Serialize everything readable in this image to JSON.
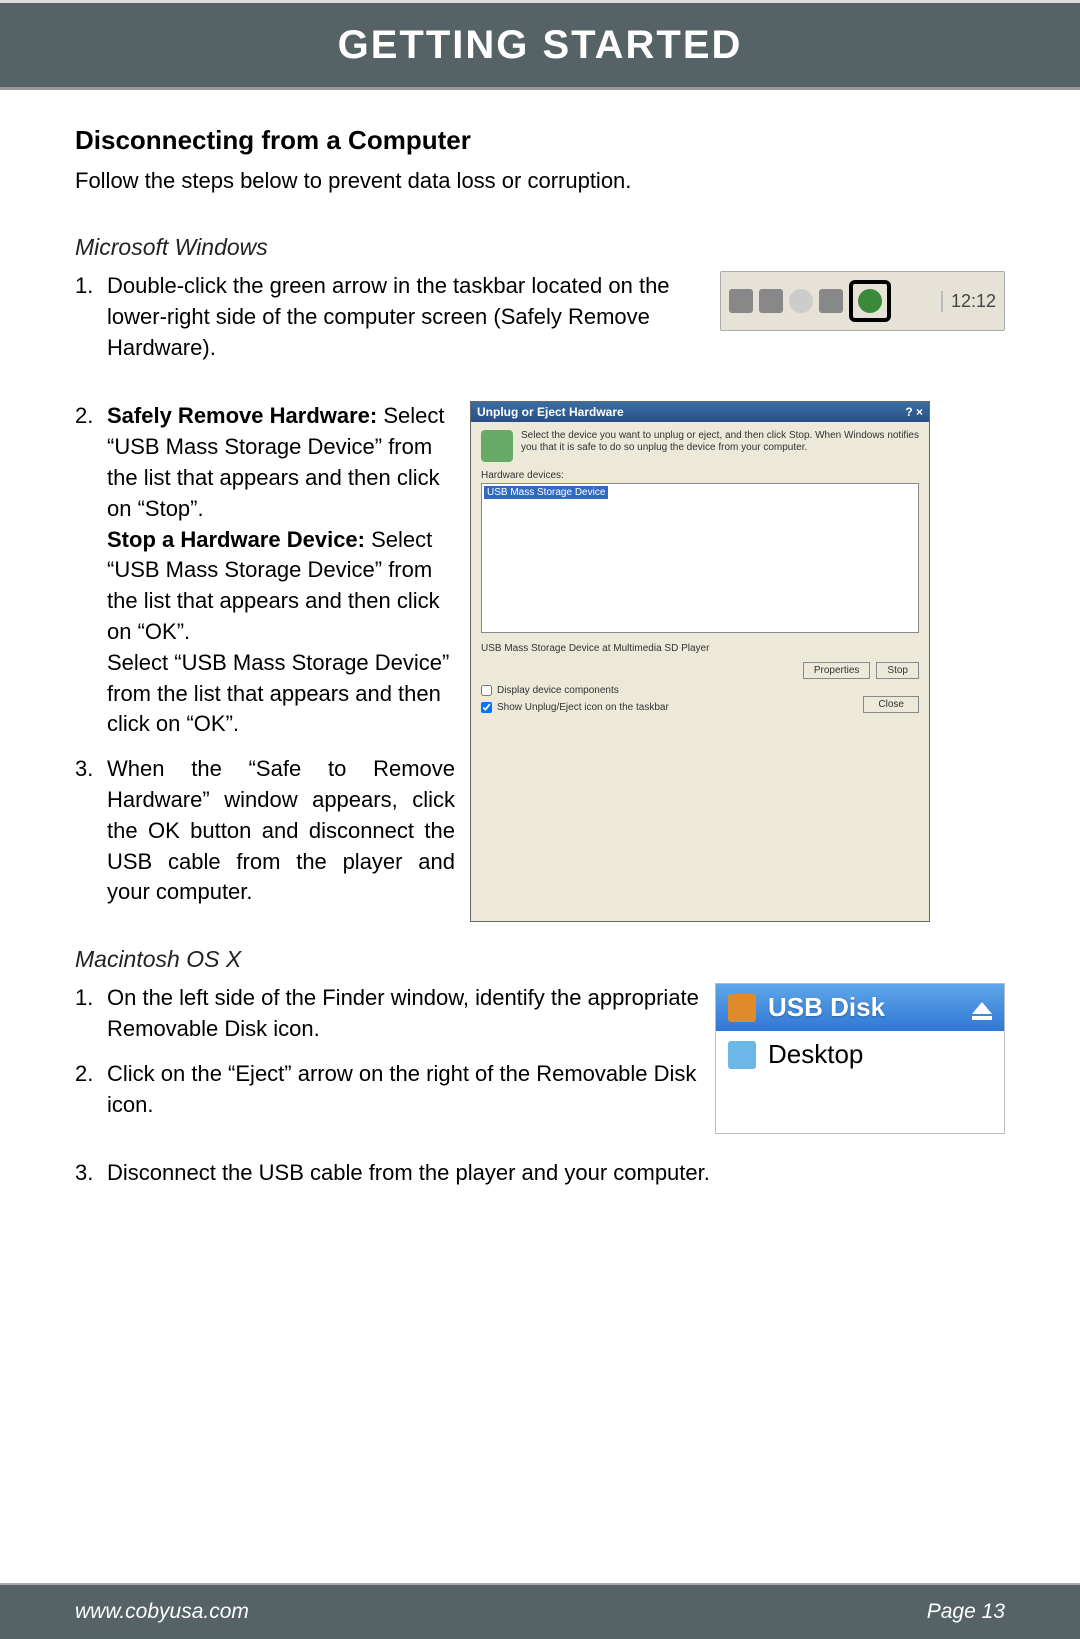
{
  "header": {
    "title": "GETTING STARTED"
  },
  "section": {
    "heading": "Disconnecting from a Computer",
    "intro": "Follow the steps below to prevent data loss or corruption."
  },
  "windows": {
    "subheading": "Microsoft Windows",
    "steps": [
      {
        "num": "1.",
        "text": "Double-click the green arrow in the taskbar located on the lower-right side of the computer screen (Safely Remove Hardware)."
      },
      {
        "num": "2.",
        "bold1": "Safely Remove Hardware:",
        "text1": "Select “USB Mass Storage Device” from the list that appears and then click on “Stop”.",
        "bold2": "Stop a Hardware Device:",
        "text2": "Select “USB Mass Storage Device” from the list that appears and then click on “OK”.",
        "text3": "Select “USB Mass Storage Device” from the list that appears and then click on “OK”."
      },
      {
        "num": "3.",
        "text": "When the “Safe to Remove Hardware” window appears, click the OK button and disconnect the USB cable from the player and your computer."
      }
    ],
    "taskbar": {
      "clock": "12:12"
    },
    "dialog": {
      "title": "Unplug or Eject Hardware",
      "note": "Select the device you want to unplug or eject, and then click Stop. When Windows notifies you that it is safe to do so unplug the device from your computer.",
      "list_label": "Hardware devices:",
      "list_item": "USB Mass Storage Device",
      "desc": "USB Mass Storage Device at Multimedia SD Player",
      "btn_properties": "Properties",
      "btn_stop": "Stop",
      "chk1": "Display device components",
      "chk2": "Show Unplug/Eject icon on the taskbar",
      "btn_close": "Close"
    }
  },
  "mac": {
    "subheading": "Macintosh OS X",
    "steps": [
      {
        "num": "1.",
        "text": "On the left side of the Finder window, identify the appropriate Removable Disk icon."
      },
      {
        "num": "2.",
        "text": "Click on the “Eject” arrow on the right of the Removable Disk icon."
      },
      {
        "num": "3.",
        "text": "Disconnect the USB cable from the player and your computer."
      }
    ],
    "finder": {
      "usb": "USB Disk",
      "desktop": "Desktop"
    }
  },
  "footer": {
    "url": "www.cobyusa.com",
    "page": "Page 13"
  }
}
